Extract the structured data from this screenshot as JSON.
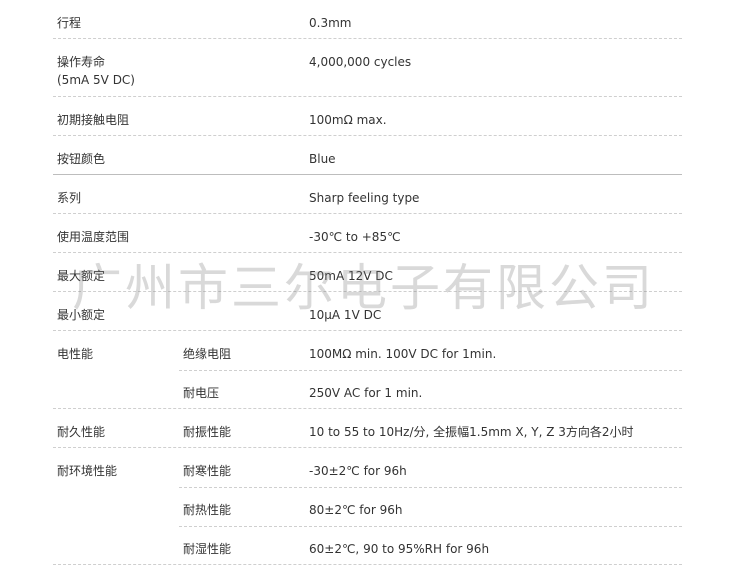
{
  "rows": [
    {
      "label": "行程",
      "value": "0.3mm"
    },
    {
      "label": "操作寿命",
      "label2": "(5mA 5V DC)",
      "value": "4,000,000 cycles"
    },
    {
      "label": "初期接触电阻",
      "value": "100mΩ max."
    },
    {
      "label": "按钮颜色",
      "value": "Blue"
    },
    {
      "label": "系列",
      "value": "Sharp feeling type"
    },
    {
      "label": "使用温度范围",
      "value": "-30℃ to +85℃"
    },
    {
      "label": "最大额定",
      "value": "50mA 12V DC"
    },
    {
      "label": "最小额定",
      "value": "10μA 1V DC"
    },
    {
      "label": "电性能",
      "sub": "绝缘电阻",
      "value": "100MΩ min. 100V DC for 1min."
    },
    {
      "sub": "耐电压",
      "value": "250V AC for 1 min."
    },
    {
      "label": "耐久性能",
      "sub": "耐振性能",
      "value": "10 to 55 to 10Hz/分, 全振幅1.5mm X, Y, Z 3方向各2小时"
    },
    {
      "label": "耐环境性能",
      "sub": "耐寒性能",
      "value": "-30±2℃ for 96h"
    },
    {
      "sub": "耐热性能",
      "value": "80±2℃ for 96h"
    },
    {
      "sub": "耐湿性能",
      "value": "60±2℃, 90 to 95%RH for 96h"
    }
  ],
  "watermark": "广州市三尔电子有限公司"
}
